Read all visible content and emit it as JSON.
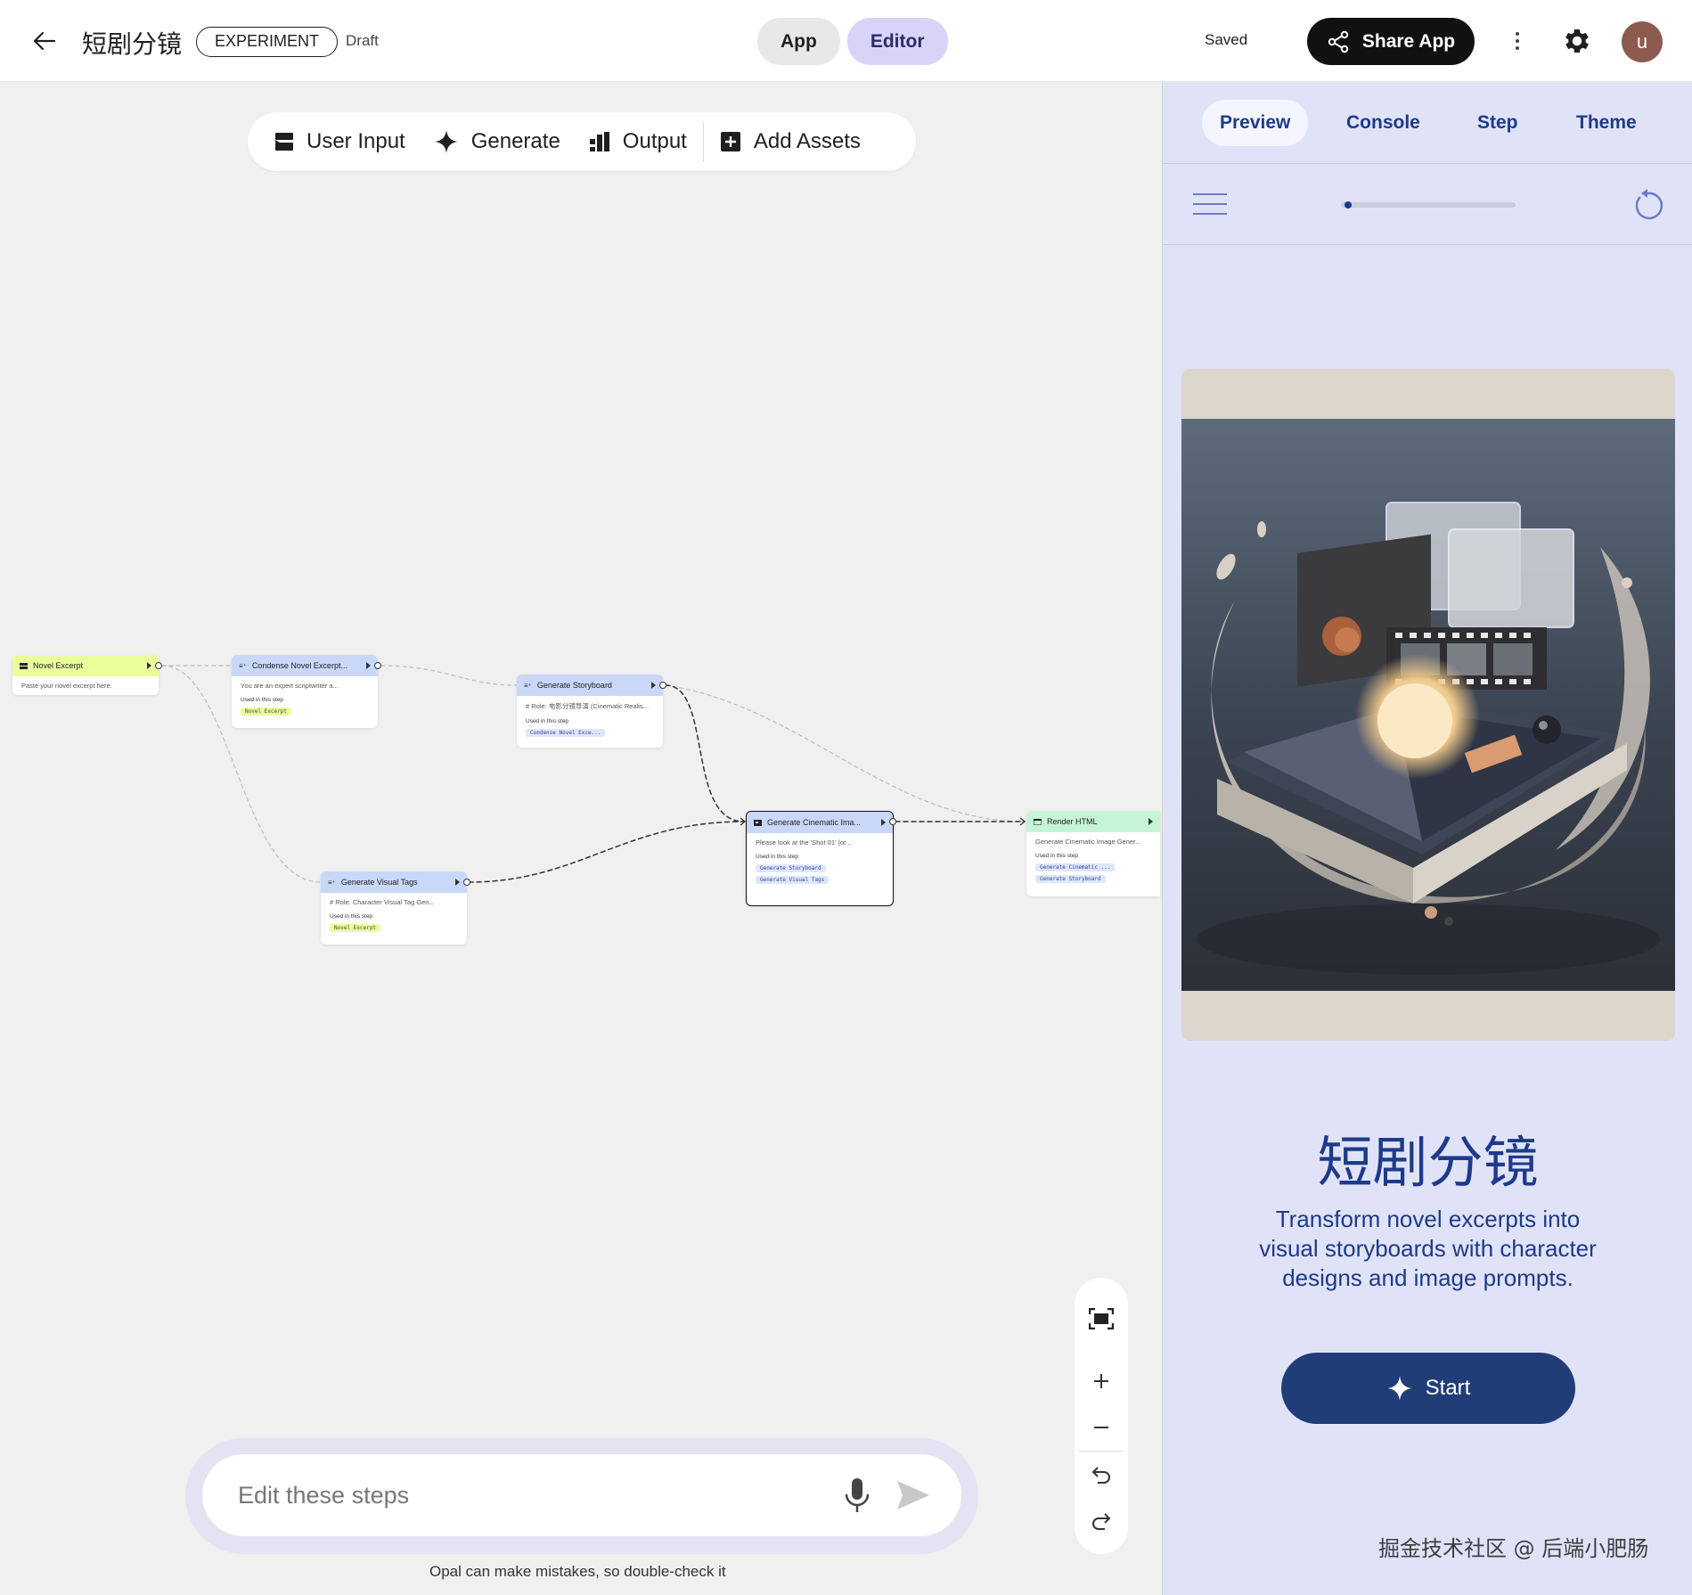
{
  "header": {
    "title": "短剧分镜",
    "badge": "EXPERIMENT",
    "status": "Draft",
    "modes": [
      "App",
      "Editor"
    ],
    "active_mode": "Editor",
    "saved_label": "Saved",
    "share_label": "Share App",
    "avatar_initial": "u"
  },
  "toolbar": {
    "user_input": "User Input",
    "generate": "Generate",
    "output": "Output",
    "add_assets": "Add Assets"
  },
  "nodes": {
    "novel_excerpt": {
      "title": "Novel Excerpt",
      "desc": "Paste your novel excerpt here."
    },
    "condense": {
      "title": "Condense Novel Excerpt...",
      "desc": "You are an expert scriptwriter a...",
      "used": "Used in this step",
      "chips": [
        "Novel Excerpt"
      ]
    },
    "storyboard": {
      "title": "Generate Storyboard",
      "desc": "# Role: 电影分镜导演 (Cinematic Realis...",
      "used": "Used in this step",
      "chips": [
        "Condense Novel Exce..."
      ]
    },
    "visual_tags": {
      "title": "Generate Visual Tags",
      "desc": "# Role: Character Visual Tag Gen...",
      "used": "Used in this step",
      "chips": [
        "Novel Excerpt"
      ]
    },
    "cinematic": {
      "title": "Generate Cinematic Ima...",
      "desc": "Please look at the 'Shot 01' (or...",
      "used": "Used in this step",
      "chips": [
        "Generate Storyboard",
        "Generate Visual Tags"
      ]
    },
    "render_html": {
      "title": "Render HTML",
      "desc": "Generate Cinematic Image Gener...",
      "used": "Used in this step",
      "chips": [
        "Generate Cinematic ...",
        "Generate Storyboard"
      ]
    }
  },
  "prompt": {
    "placeholder": "Edit these steps",
    "disclaimer": "Opal can make mistakes, so double-check it"
  },
  "panel": {
    "tabs": [
      "Preview",
      "Console",
      "Step",
      "Theme"
    ],
    "active_tab": "Preview",
    "progress": 0.02,
    "app_title": "短剧分镜",
    "app_description": "Transform novel excerpts into visual storyboards with character designs and image prompts.",
    "start_label": "Start",
    "watermark": "掘金技术社区 @ 后端小肥肠"
  },
  "colors": {
    "accent": "#1e3a8a",
    "panel_bg": "#e0e3f7",
    "editor_tab": "#d8d3f8",
    "input_node": "#e9ff9c",
    "generate_node": "#c9d8f8",
    "output_node": "#c6f5d6"
  },
  "icons": {
    "back": "arrow-left-icon",
    "share": "share-icon",
    "settings": "gear-icon",
    "zoom_fit": "fit-screen-icon",
    "zoom_in": "plus-icon",
    "zoom_out": "minus-icon",
    "undo": "undo-icon",
    "redo": "redo-icon",
    "mic": "microphone-icon",
    "send": "send-icon",
    "menu": "hamburger-menu-icon",
    "restart": "restart-icon",
    "sparkle": "sparkle-icon"
  }
}
